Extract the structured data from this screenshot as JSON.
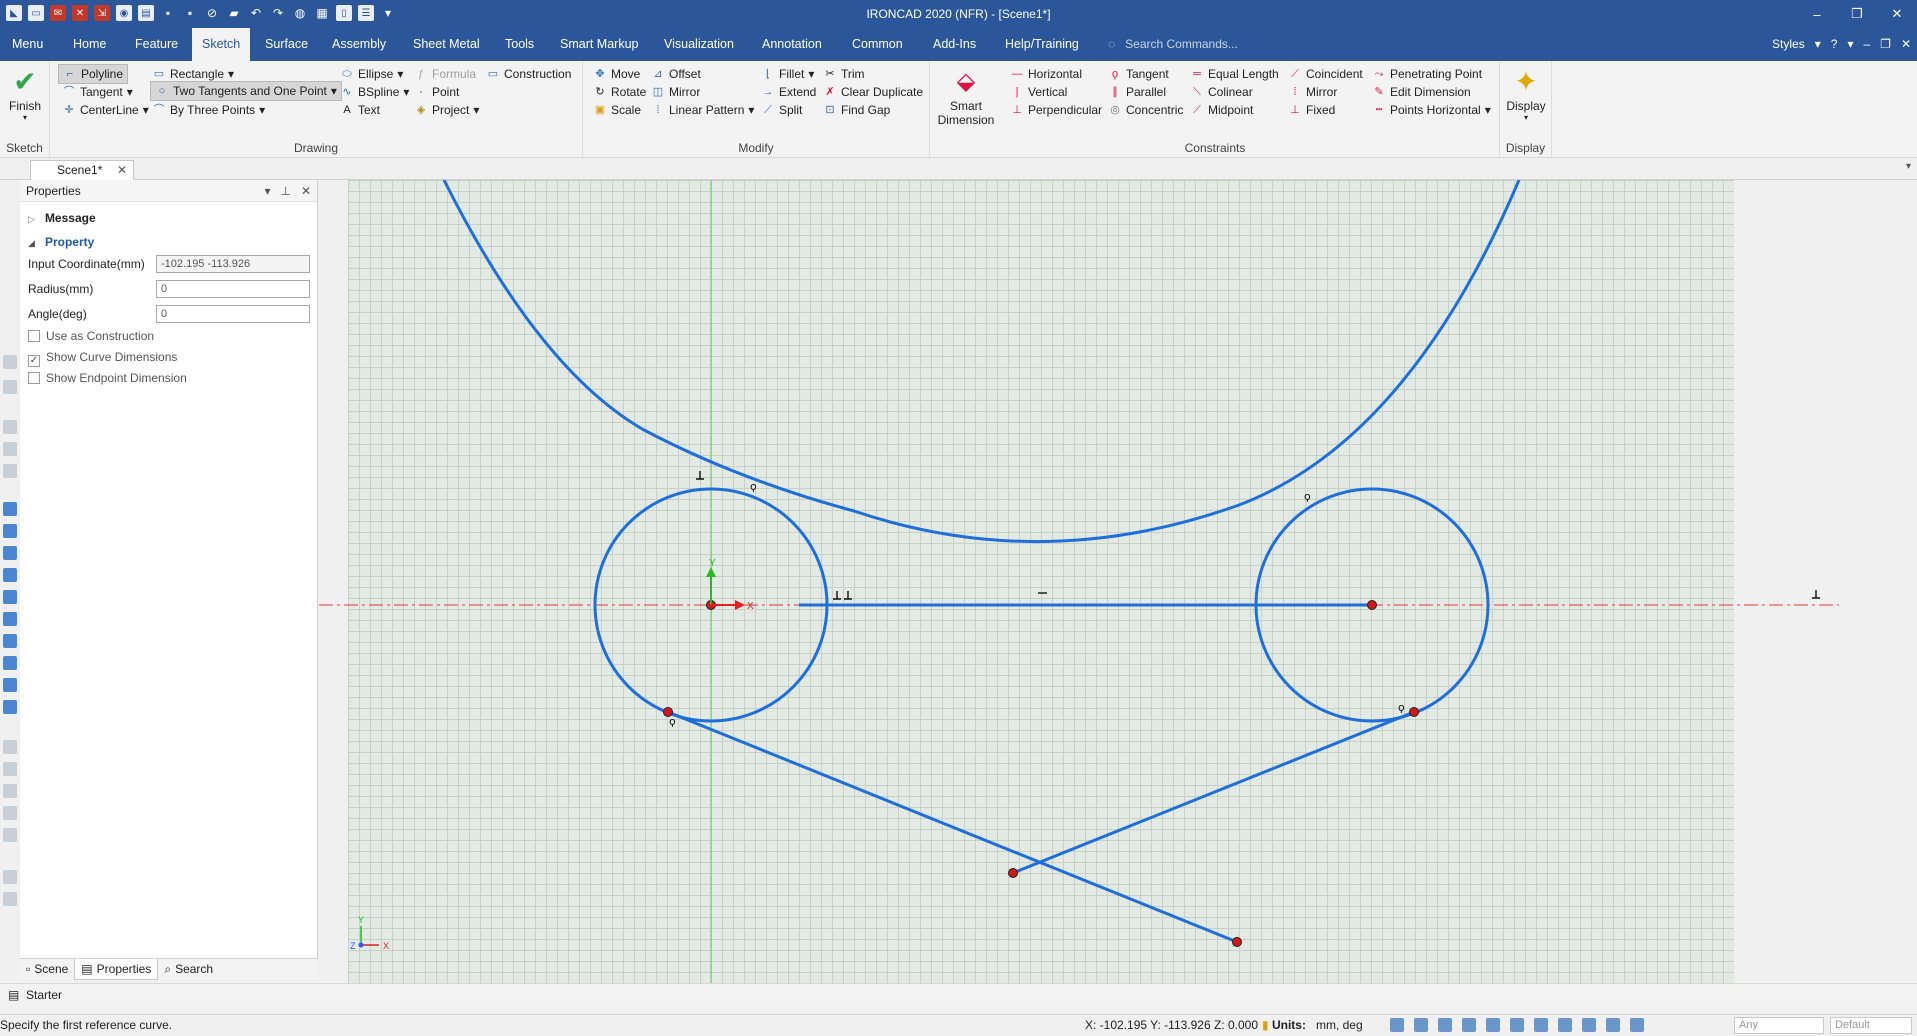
{
  "app": {
    "title": "IRONCAD 2020 (NFR) - [Scene1*]"
  },
  "tabs": [
    "Menu",
    "Home",
    "Feature",
    "Sketch",
    "Surface",
    "Assembly",
    "Sheet Metal",
    "Tools",
    "Smart Markup",
    "Visualization",
    "Annotation",
    "Common",
    "Add-Ins",
    "Help/Training"
  ],
  "active_tab": "Sketch",
  "search_commands": "Search Commands...",
  "styles_label": "Styles",
  "ribbon": {
    "sketch_group": {
      "finish": "Finish",
      "label": "Sketch"
    },
    "drawing": {
      "label": "Drawing",
      "polyline": "Polyline",
      "tangent": "Tangent",
      "centerline": "CenterLine",
      "rectangle": "Rectangle",
      "two_tangents": "Two Tangents and One Point",
      "by_three_points": "By Three Points",
      "ellipse": "Ellipse",
      "bspline": "BSpline",
      "text": "Text",
      "formula": "Formula",
      "point": "Point",
      "project": "Project",
      "construction": "Construction"
    },
    "modify": {
      "label": "Modify",
      "move": "Move",
      "rotate": "Rotate",
      "scale": "Scale",
      "offset": "Offset",
      "mirror": "Mirror",
      "linear_pattern": "Linear Pattern",
      "fillet": "Fillet",
      "extend": "Extend",
      "split": "Split",
      "trim": "Trim",
      "clear_duplicate": "Clear Duplicate",
      "find_gap": "Find Gap"
    },
    "smart_dimension": {
      "line1": "Smart",
      "line2": "Dimension"
    },
    "constraints": {
      "label": "Constraints",
      "horizontal": "Horizontal",
      "vertical": "Vertical",
      "perpendicular": "Perpendicular",
      "tangent": "Tangent",
      "parallel": "Parallel",
      "concentric": "Concentric",
      "equal_length": "Equal Length",
      "colinear": "Colinear",
      "midpoint": "Midpoint",
      "coincident": "Coincident",
      "mirror": "Mirror",
      "fixed": "Fixed",
      "penetrating_point": "Penetrating Point",
      "edit_dimension": "Edit Dimension",
      "points_horizontal": "Points Horizontal"
    },
    "display": {
      "button": "Display",
      "label": "Display"
    }
  },
  "doc_tab": "Scene1*",
  "properties": {
    "title": "Properties",
    "message_section": "Message",
    "property_section": "Property",
    "input_coordinate_label": "Input Coordinate(mm)",
    "input_coordinate_value": "-102.195 -113.926",
    "radius_label": "Radius(mm)",
    "radius_value": "0",
    "angle_label": "Angle(deg)",
    "angle_value": "0",
    "use_as_construction": "Use as Construction",
    "show_curve_dimensions": "Show Curve Dimensions",
    "show_endpoint_dimension": "Show Endpoint Dimension",
    "tabs": {
      "scene": "Scene",
      "properties": "Properties",
      "search": "Search"
    }
  },
  "sketch": {
    "axis_x": "X",
    "axis_y": "Y",
    "mini_x": "X",
    "mini_y": "Y",
    "mini_z": "Z",
    "line_color": "#1e6fd9"
  },
  "starter": "Starter",
  "status": {
    "message": "Specify the first reference curve.",
    "coords": "X: -102.195 Y: -113.926 Z: 0.000",
    "units_label": "Units:",
    "units_value": "mm, deg",
    "any": "Any",
    "default": "Default"
  }
}
